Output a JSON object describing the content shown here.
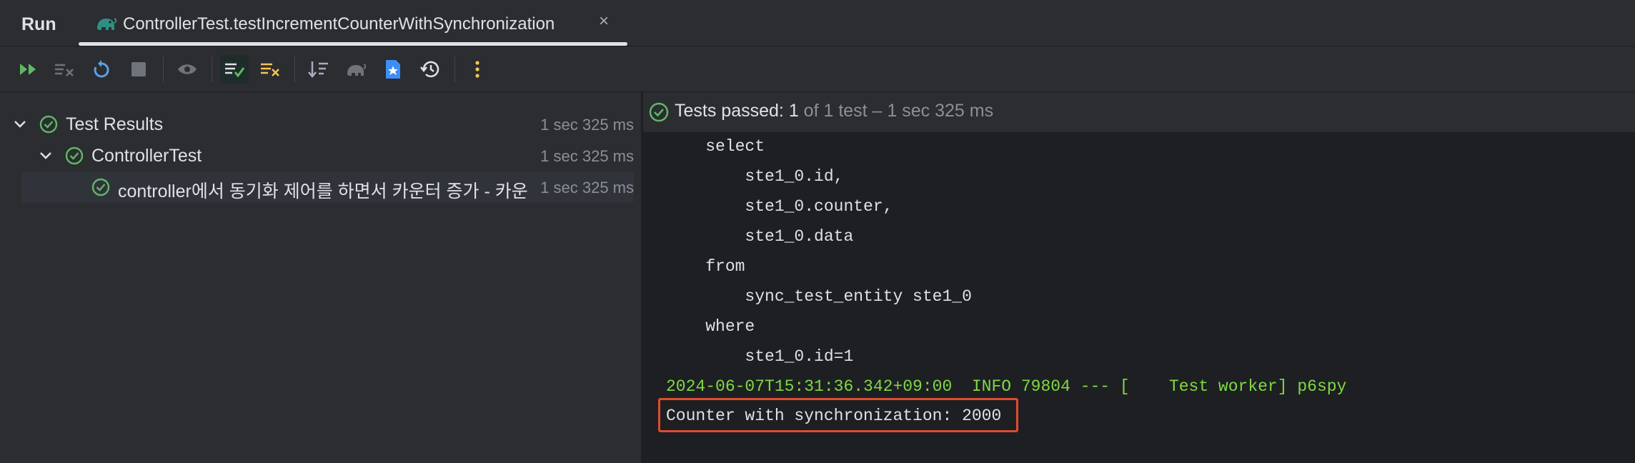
{
  "tabbar": {
    "run_label": "Run",
    "tab_title": "ControllerTest.testIncrementCounterWithSynchronization",
    "close_glyph": "×"
  },
  "toolbar": {
    "buttons": [
      {
        "name": "rerun-all-icon"
      },
      {
        "name": "rerun-failed-icon"
      },
      {
        "name": "rerun-icon"
      },
      {
        "name": "stop-icon"
      },
      {
        "name": "show-passed-icon"
      },
      {
        "name": "show-passed-toggle-icon"
      },
      {
        "name": "show-ignored-icon"
      },
      {
        "name": "sort-icon"
      },
      {
        "name": "gradle-icon"
      },
      {
        "name": "export-icon"
      },
      {
        "name": "history-icon"
      },
      {
        "name": "more-options-icon"
      }
    ]
  },
  "tree": {
    "root": {
      "label": "Test Results",
      "time": "1 sec 325 ms"
    },
    "class": {
      "label": "ControllerTest",
      "time": "1 sec 325 ms"
    },
    "method": {
      "label": "controller에서 동기화 제어를 하면서 카운터 증가 - 카운",
      "time": "1 sec 325 ms"
    }
  },
  "status": {
    "passed_label": "Tests passed:",
    "passed_count": "1",
    "detail": "of 1 test – 1 sec 325 ms"
  },
  "console": {
    "lines": [
      "    select",
      "        ste1_0.id,",
      "        ste1_0.counter,",
      "        ste1_0.data",
      "    from",
      "        sync_test_entity ste1_0",
      "    where",
      "        ste1_0.id=1",
      "2024-06-07T15:31:36.342+09:00  INFO 79804 --- [    Test worker] p6spy",
      "Counter with synchronization: 2000"
    ]
  },
  "colors": {
    "accent_green": "#7ddb43",
    "pass_check": "#5fb865",
    "highlight_border": "#e04b2f",
    "warning_yellow": "#f2c55c",
    "link_blue": "#3d8ef7"
  }
}
